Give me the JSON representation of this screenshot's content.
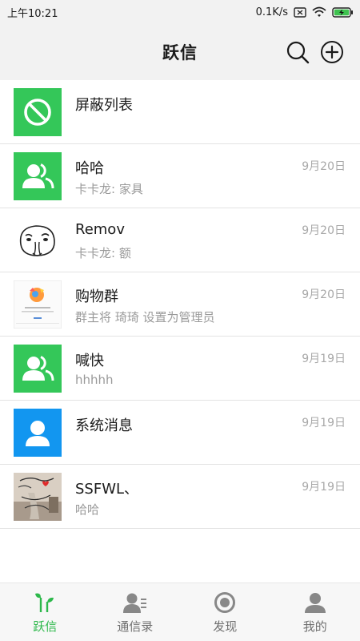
{
  "status_bar": {
    "time": "上午10:21",
    "net_speed": "0.1K/s",
    "icons": [
      "sim-off-icon",
      "wifi-icon",
      "battery-charging-icon"
    ]
  },
  "header": {
    "title": "跃信",
    "icons": [
      "search-icon",
      "add-circle-icon"
    ]
  },
  "conversations": [
    {
      "name": "屏蔽列表",
      "preview": "",
      "time": "",
      "avatar": "block-icon"
    },
    {
      "name": "哈哈",
      "preview": "卡卡龙: 家具",
      "time": "9月20日",
      "avatar": "group-icon"
    },
    {
      "name": "Remov",
      "preview": "卡卡龙: 额",
      "time": "9月20日",
      "avatar": "sticker-face"
    },
    {
      "name": "购物群",
      "preview": "群主将 琦琦 设置为管理员",
      "time": "9月20日",
      "avatar": "screenshot-thumbnail"
    },
    {
      "name": "喊快",
      "preview": "hhhhh",
      "time": "9月19日",
      "avatar": "group-icon"
    },
    {
      "name": "系统消息",
      "preview": "",
      "time": "9月19日",
      "avatar": "person-icon"
    },
    {
      "name": "SSFWL、",
      "preview": "哈哈",
      "time": "9月19日",
      "avatar": "photo-thumbnail"
    }
  ],
  "tabs": [
    {
      "label": "跃信",
      "icon": "chat-tab-icon",
      "active": true
    },
    {
      "label": "通信录",
      "icon": "contacts-icon",
      "active": false
    },
    {
      "label": "发现",
      "icon": "discover-icon",
      "active": false
    },
    {
      "label": "我的",
      "icon": "profile-icon",
      "active": false
    }
  ],
  "colors": {
    "accent_green": "#2db84b",
    "avatar_green": "#34c759",
    "avatar_blue": "#1296f0",
    "header_bg": "#f2f2f2"
  }
}
